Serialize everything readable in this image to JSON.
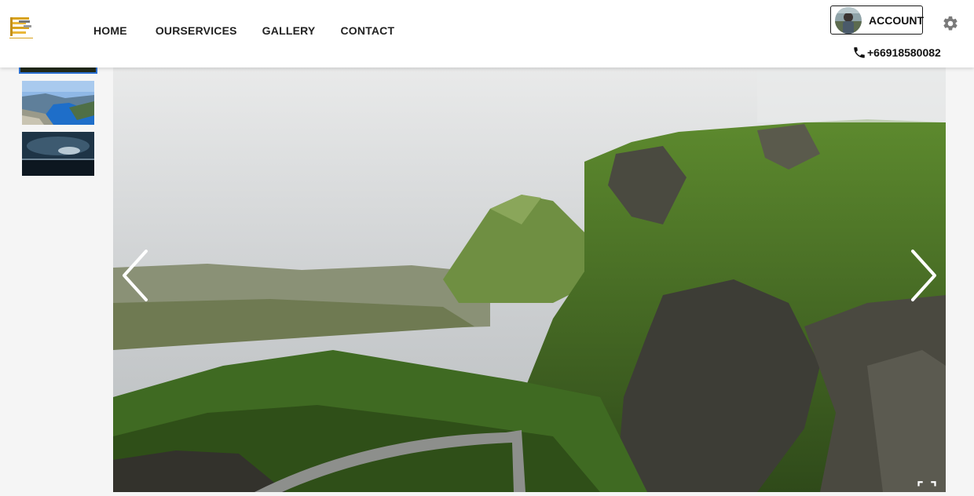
{
  "header": {
    "logo_icon": "building-logo-icon",
    "nav": [
      {
        "label": "HOME"
      },
      {
        "label": "OURSERVICES"
      },
      {
        "label": "GALLERY"
      },
      {
        "label": "CONTACT"
      }
    ],
    "account_label": "ACCOUNT",
    "settings_icon": "gear-icon",
    "phone": "+66918580082",
    "phone_icon": "phone-icon"
  },
  "gallery": {
    "thumbnails": [
      {
        "name": "thumb-mountain",
        "active": true
      },
      {
        "name": "thumb-fjord",
        "active": false
      },
      {
        "name": "thumb-stormy-sea",
        "active": false
      }
    ],
    "prev_icon": "chevron-left-icon",
    "next_icon": "chevron-right-icon",
    "fullscreen_icon": "fullscreen-icon"
  },
  "colors": {
    "accent": "#2a6fd1",
    "header_bg": "#ffffff",
    "page_bg": "#f5f5f5",
    "text": "#222222"
  }
}
